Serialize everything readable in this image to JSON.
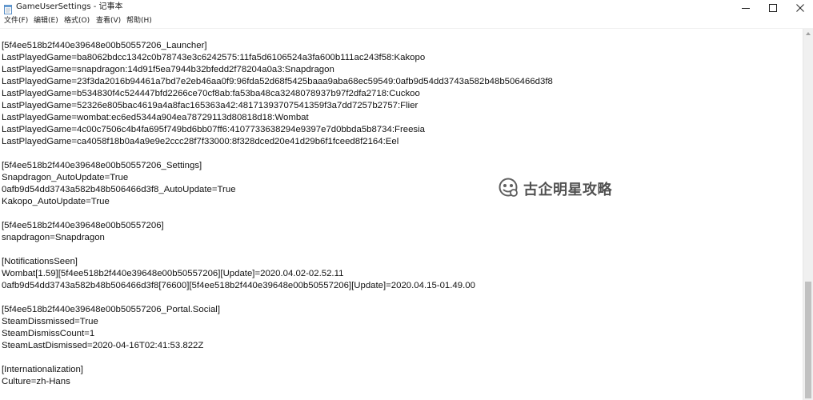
{
  "window": {
    "title": "GameUserSettings - 记事本"
  },
  "menu": [
    {
      "label": "文件(F)"
    },
    {
      "label": "编辑(E)"
    },
    {
      "label": "格式(O)"
    },
    {
      "label": "查看(V)"
    },
    {
      "label": "帮助(H)"
    }
  ],
  "editor": {
    "lines": [
      "[5f4ee518b2f440e39648e00b50557206_Launcher]",
      "LastPlayedGame=ba8062bdcc1342c0b78743e3c6242575:11fa5d6106524a3fa600b111ac243f58:Kakopo",
      "LastPlayedGame=snapdragon:14d91f5ea7944b32bfedd2f78204a0a3:Snapdragon",
      "LastPlayedGame=23f3da2016b94461a7bd7e2eb46aa0f9:96fda52d68f5425baaa9aba68ec59549:0afb9d54dd3743a582b48b506466d3f8",
      "LastPlayedGame=b534830f4c524447bfd2266ce70cf8ab:fa53ba48ca3248078937b97f2dfa2718:Cuckoo",
      "LastPlayedGame=52326e805bac4619a4a8fac165363a42:48171393707541359f3a7dd7257b2757:Flier",
      "LastPlayedGame=wombat:ec6ed5344a904ea78729113d80818d18:Wombat",
      "LastPlayedGame=4c00c7506c4b4fa695f749bd6bb07ff6:4107733638294e9397e7d0bbda5b8734:Freesia",
      "LastPlayedGame=ca4058f18b0a4a9e9e2ccc28f7f33000:8f328dced20e41d29b6f1fceed8f2164:Eel",
      "",
      "[5f4ee518b2f440e39648e00b50557206_Settings]",
      "Snapdragon_AutoUpdate=True",
      "0afb9d54dd3743a582b48b506466d3f8_AutoUpdate=True",
      "Kakopo_AutoUpdate=True",
      "",
      "[5f4ee518b2f440e39648e00b50557206]",
      "snapdragon=Snapdragon",
      "",
      "[NotificationsSeen]",
      "Wombat[1.59][5f4ee518b2f440e39648e00b50557206][Update]=2020.04.02-02.52.11",
      "0afb9d54dd3743a582b48b506466d3f8[76600][5f4ee518b2f440e39648e00b50557206][Update]=2020.04.15-01.49.00",
      "",
      "[5f4ee518b2f440e39648e00b50557206_Portal.Social]",
      "SteamDissmissed=True",
      "SteamDismissCount=1",
      "SteamLastDismissed=2020-04-16T02:41:53.822Z",
      "",
      "[Internationalization]",
      "Culture=zh-Hans"
    ]
  },
  "watermark": {
    "text": "古企明星攻略",
    "icon": "watermark-logo-icon"
  },
  "icons": {
    "app": "notepad-icon",
    "minimize": "minimize-icon",
    "maximize": "maximize-icon",
    "close": "close-icon"
  }
}
